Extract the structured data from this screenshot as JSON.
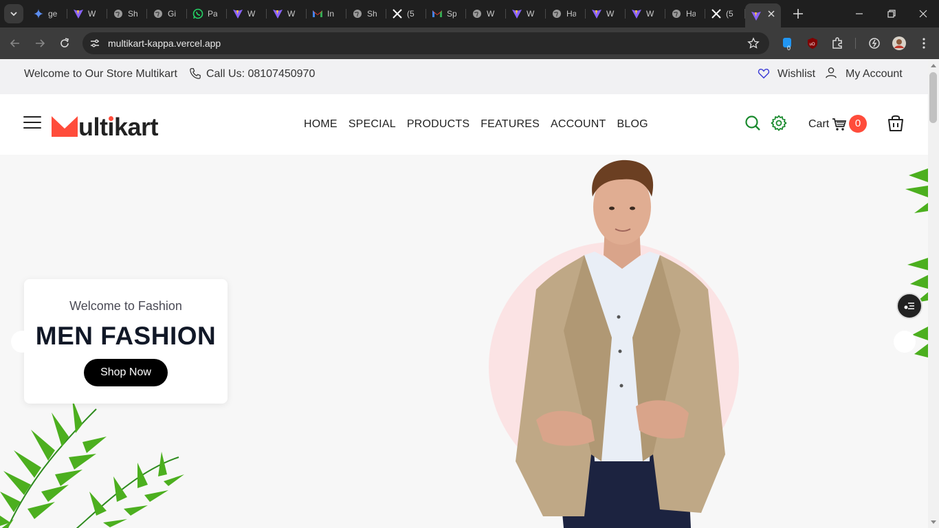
{
  "browser": {
    "tabs": [
      {
        "title": "ge",
        "icon": "gemini-icon"
      },
      {
        "title": "W",
        "icon": "vite-icon"
      },
      {
        "title": "Sh",
        "icon": "globe-icon"
      },
      {
        "title": "Gi",
        "icon": "globe-icon"
      },
      {
        "title": "Pa",
        "icon": "whatsapp-icon"
      },
      {
        "title": "W",
        "icon": "vite-icon"
      },
      {
        "title": "W",
        "icon": "vite-icon"
      },
      {
        "title": "In",
        "icon": "gmail-icon"
      },
      {
        "title": "Sh",
        "icon": "globe-icon"
      },
      {
        "title": "(5",
        "icon": "x-icon"
      },
      {
        "title": "Sp",
        "icon": "gmail-icon"
      },
      {
        "title": "W",
        "icon": "globe-icon"
      },
      {
        "title": "W",
        "icon": "vite-icon"
      },
      {
        "title": "Ha",
        "icon": "globe-icon"
      },
      {
        "title": "W",
        "icon": "vite-icon"
      },
      {
        "title": "W",
        "icon": "vite-icon"
      },
      {
        "title": "Ha",
        "icon": "globe-icon"
      },
      {
        "title": "(5",
        "icon": "x-icon"
      },
      {
        "title": "",
        "icon": "vite-icon",
        "active": true
      }
    ],
    "url": "multikart-kappa.vercel.app",
    "extension_badge": "0"
  },
  "topbar": {
    "welcome": "Welcome to Our Store Multikart",
    "call": "Call Us: 08107450970",
    "wishlist": "Wishlist",
    "account": "My Account"
  },
  "header": {
    "logo_first": "M",
    "logo_rest_a": "ult",
    "logo_i": "i",
    "logo_rest_b": "kart",
    "nav": [
      "HOME",
      "SPECIAL",
      "PRODUCTS",
      "FEATURES",
      "ACCOUNT",
      "BLOG"
    ],
    "cart_label": "Cart",
    "cart_count": "0"
  },
  "hero": {
    "kicker": "Welcome to Fashion",
    "headline": "MEN FASHION",
    "button": "Shop Now"
  },
  "colors": {
    "accent": "#ff4c3b",
    "icon_green": "#1a8a2e",
    "hero_circle": "#fbe3e4"
  }
}
